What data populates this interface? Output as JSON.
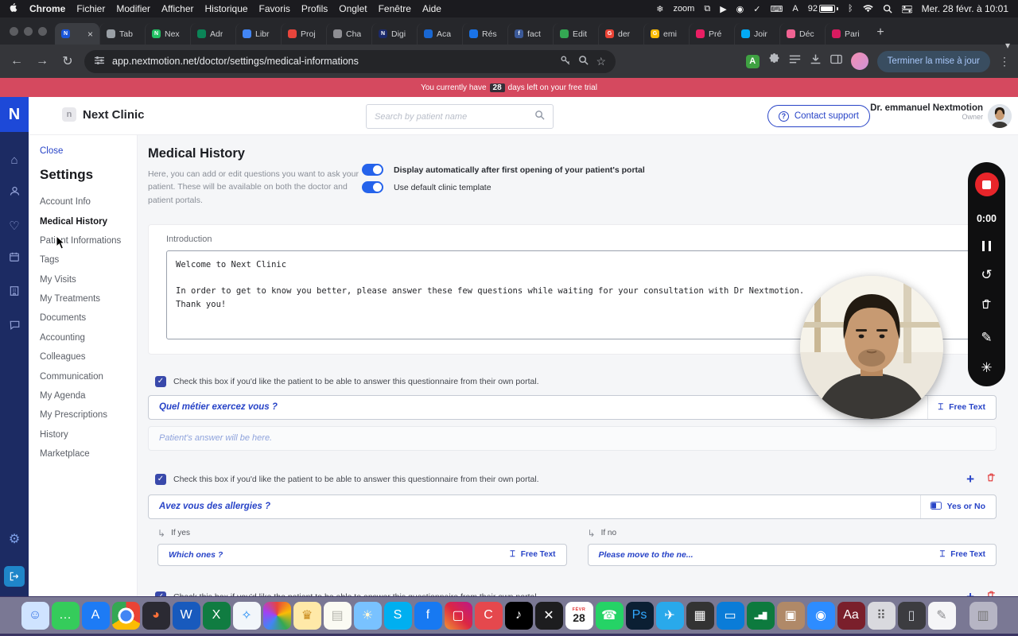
{
  "colors": {
    "primary": "#2743c7",
    "danger": "#e03131",
    "toggle_on": "#2563eb",
    "trial_banner": "#d5495f",
    "rail": "#1c2b63"
  },
  "menubar": {
    "menus": [
      "Chrome",
      "Fichier",
      "Modifier",
      "Afficher",
      "Historique",
      "Favoris",
      "Profils",
      "Onglet",
      "Fenêtre",
      "Aide"
    ],
    "icons": {
      "snowflake": "❄",
      "zoom": "zoom",
      "mirror": "⧉",
      "play": "▶",
      "record": "◉",
      "check": "✓",
      "keyboard": "⌨",
      "input": "A",
      "battery_pct": "92",
      "bluetooth": "ᛒ"
    },
    "clock": "Mer. 28 févr. à 10:01"
  },
  "browser": {
    "active_tab": {
      "glyph": "N",
      "color": "#1a56db",
      "close": "×"
    },
    "tabs": [
      {
        "label": "Tab",
        "color": "#9aa0a6"
      },
      {
        "label": "Nex",
        "color": "#21c063",
        "glyph": "N"
      },
      {
        "label": "Adr",
        "color": "#0b8457"
      },
      {
        "label": "Libr",
        "color": "#4285f4"
      },
      {
        "label": "Proj",
        "color": "#e8453c"
      },
      {
        "label": "Cha",
        "color": "#8e8e93"
      },
      {
        "label": "Digi",
        "color": "#1b2a6b",
        "glyph": "N"
      },
      {
        "label": "Aca",
        "color": "#1967d2"
      },
      {
        "label": "Rés",
        "color": "#1a73e8"
      },
      {
        "label": "fact",
        "color": "#3b5998",
        "glyph": "f"
      },
      {
        "label": "Edit",
        "color": "#34a853"
      },
      {
        "label": "der",
        "color": "#ea4335",
        "glyph": "G"
      },
      {
        "label": "emi",
        "color": "#fbbc05",
        "glyph": "G"
      },
      {
        "label": "Pré",
        "color": "#e91e63"
      },
      {
        "label": "Joir",
        "color": "#03a9f4"
      },
      {
        "label": "Déc",
        "color": "#f06292"
      },
      {
        "label": "Pari",
        "color": "#d81b60"
      }
    ],
    "url": "app.nextmotion.net/doctor/settings/medical-informations",
    "update_button": "Terminer la mise à jour"
  },
  "trial": {
    "prefix": "You currently have",
    "badge": "28",
    "suffix": "days left on your free trial"
  },
  "app": {
    "header": {
      "brand": "Next Clinic",
      "search_placeholder": "Search by patient name",
      "contact": "Contact support",
      "doctor": "Dr. emmanuel Nextmotion",
      "role": "Owner",
      "logo_letter": "N"
    },
    "rail_icons": [
      "home",
      "patients",
      "favorites",
      "agenda",
      "clinic",
      "chat",
      "settings",
      "logout"
    ],
    "sidebar": {
      "close": "Close",
      "title": "Settings",
      "items": [
        {
          "label": "Account Info"
        },
        {
          "label": "Medical History",
          "active": true
        },
        {
          "label": "Patient Informations"
        },
        {
          "label": "Tags"
        },
        {
          "label": "My Visits"
        },
        {
          "label": "My Treatments"
        },
        {
          "label": "Documents"
        },
        {
          "label": "Accounting"
        },
        {
          "label": "Colleagues"
        },
        {
          "label": "Communication"
        },
        {
          "label": "My Agenda"
        },
        {
          "label": "My Prescriptions"
        },
        {
          "label": "History"
        },
        {
          "label": "Marketplace"
        }
      ]
    },
    "main": {
      "title": "Medical History",
      "description_line1": "Here, you can add or edit questions you want to ask your patient.",
      "description_line2": "These will be available on both the doctor and patient portals.",
      "toggle1": "Display automatically after first opening of your patient's portal",
      "toggle2": "Use default clinic template",
      "intro_label": "Introduction",
      "intro_text": "Welcome to Next Clinic\n\nIn order to get to know you better, please answer these few questions while waiting for your consultation with Dr Nextmotion.\nThank you!",
      "checkbox_label": "Check this box if you'd like the patient to be able to answer this questionnaire from their own portal.",
      "check_glyph": "✓",
      "type_icon_text": "⌶",
      "q1": {
        "question": "Quel métier exercez vous ?",
        "type_label": "Free Text",
        "answer": "Patient's answer will be here."
      },
      "q2": {
        "question": "Avez vous des allergies ?",
        "type_label": "Yes or No",
        "if_yes": "If yes",
        "yes_question": "Which ones ?",
        "yes_type": "Free Text",
        "if_no": "If no",
        "no_question": "Please move to the ne...",
        "no_type": "Free Text",
        "branch_arrow": "↳"
      }
    }
  },
  "recorder": {
    "time": "0:00",
    "buttons": [
      "stop",
      "pause",
      "restart",
      "delete",
      "edit",
      "enhance"
    ],
    "restart_glyph": "↺",
    "edit_glyph": "✎",
    "enhance_glyph": "✳"
  },
  "dock": {
    "items": [
      {
        "name": "finder",
        "glyph": "☺",
        "bg": "#cfe3ff",
        "fg": "#2f6fe4"
      },
      {
        "name": "messages",
        "glyph": "…",
        "bg": "#35cc5b",
        "fg": "#ffffff"
      },
      {
        "name": "app-store",
        "glyph": "A",
        "bg": "#1d7bf5",
        "fg": "#ffffff"
      },
      {
        "name": "chrome",
        "glyph": "",
        "cls": "ic-chrome"
      },
      {
        "name": "firefox",
        "glyph": "◕",
        "bg": "#2b2a33",
        "fg": "#ff7139"
      },
      {
        "name": "word",
        "glyph": "W",
        "bg": "#185abd",
        "fg": "#ffffff"
      },
      {
        "name": "excel",
        "glyph": "X",
        "bg": "#107c41",
        "fg": "#ffffff"
      },
      {
        "name": "safari",
        "glyph": "✧",
        "bg": "#f2f6fa",
        "fg": "#1b88f4"
      },
      {
        "name": "photos-sphere",
        "glyph": "",
        "cls": "ic-rainbow"
      },
      {
        "name": "pineapple",
        "glyph": "♛",
        "bg": "#ffe9a8",
        "fg": "#c98a1b"
      },
      {
        "name": "notes",
        "glyph": "▤",
        "bg": "#fbfbf3",
        "fg": "#b5b5ad"
      },
      {
        "name": "weather",
        "glyph": "☀",
        "bg": "#79c2ff",
        "fg": "#fff8d8"
      },
      {
        "name": "skype",
        "glyph": "S",
        "bg": "#00aff0",
        "fg": "#ffffff"
      },
      {
        "name": "facebook",
        "glyph": "f",
        "bg": "#1779f2",
        "fg": "#ffffff"
      },
      {
        "name": "camera-app",
        "glyph": "▢",
        "cls": "ic-insta",
        "fg": "#ffffff"
      },
      {
        "name": "red-c-app",
        "glyph": "C",
        "bg": "#e5484d",
        "fg": "#ffffff"
      },
      {
        "name": "tiktok",
        "glyph": "♪",
        "bg": "#000000",
        "fg": "#ffffff"
      },
      {
        "name": "x-app",
        "glyph": "✕",
        "bg": "#1d1d1f",
        "fg": "#ffffff"
      },
      {
        "name": "calendar",
        "glyph": "28",
        "top": "FÉVR",
        "bg": "#ffffff",
        "fg": "#222222",
        "cls": "ic-cal"
      },
      {
        "name": "whatsapp",
        "glyph": "☎",
        "bg": "#25d366",
        "fg": "#ffffff"
      },
      {
        "name": "photoshop",
        "glyph": "Ps",
        "bg": "#0b1f33",
        "fg": "#31a8ff"
      },
      {
        "name": "telegram",
        "glyph": "✈",
        "bg": "#29a9eb",
        "fg": "#ffffff"
      },
      {
        "name": "calculator",
        "glyph": "▦",
        "bg": "#333333",
        "fg": "#ffffff"
      },
      {
        "name": "remote-desktop",
        "glyph": "▭",
        "bg": "#0a7cd8",
        "fg": "#ffffff"
      },
      {
        "name": "stocks",
        "glyph": "▂▅█",
        "bg": "#0d7a3e",
        "fg": "#ffffff",
        "cls": "ic-bars"
      },
      {
        "name": "archive-app",
        "glyph": "▣",
        "bg": "#b08968",
        "fg": "#ffffff"
      },
      {
        "name": "zoom",
        "glyph": "◉",
        "bg": "#2d8cff",
        "fg": "#ffffff"
      },
      {
        "name": "font-book",
        "glyph": "Aa",
        "bg": "#7a1f2b",
        "fg": "#ffffff"
      },
      {
        "name": "launchpad",
        "glyph": "⠿",
        "bg": "#d9d9de",
        "fg": "#555555"
      },
      {
        "name": "monitor",
        "glyph": "▯",
        "bg": "#3c3c40",
        "fg": "#cfd3da"
      },
      {
        "name": "textedit",
        "glyph": "✎",
        "bg": "#f5f5f7",
        "fg": "#8a8a8e"
      },
      {
        "name": "trash",
        "glyph": "▥",
        "bg": "rgba(255,255,255,0.45)",
        "fg": "#777777",
        "cls": "ic-trash"
      }
    ]
  }
}
